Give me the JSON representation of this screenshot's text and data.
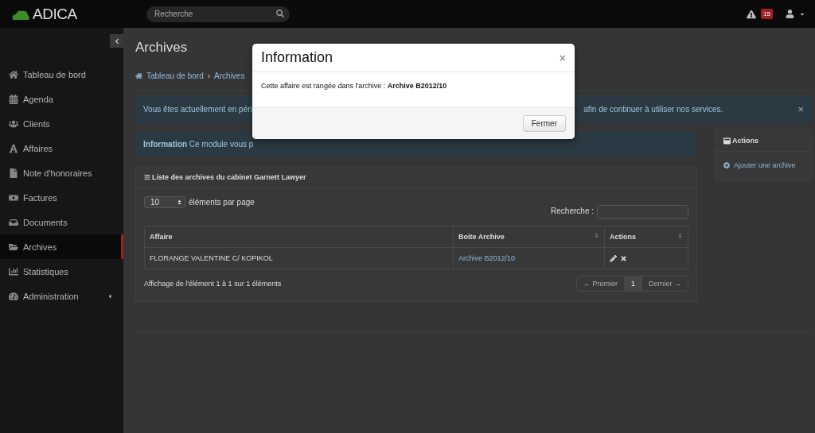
{
  "topbar": {
    "logo": "ADICA",
    "search": {
      "placeholder": "Recherche"
    },
    "alert_count": "15"
  },
  "sidebar": {
    "items": [
      {
        "label": "Tableau de bord",
        "selected": false,
        "submenu": false
      },
      {
        "label": "Agenda",
        "selected": false,
        "submenu": false
      },
      {
        "label": "Clients",
        "selected": false,
        "submenu": false
      },
      {
        "label": "Affaires",
        "selected": false,
        "submenu": false
      },
      {
        "label": "Note d'honoraires",
        "selected": false,
        "submenu": false
      },
      {
        "label": "Factures",
        "selected": false,
        "submenu": false
      },
      {
        "label": "Documents",
        "selected": false,
        "submenu": false
      },
      {
        "label": "Archives",
        "selected": true,
        "submenu": false
      },
      {
        "label": "Statistiques",
        "selected": false,
        "submenu": false
      },
      {
        "label": "Administration",
        "selected": false,
        "submenu": true
      }
    ]
  },
  "page": {
    "title": "Archives",
    "breadcrumb": [
      "Tableau de bord",
      "Archives"
    ],
    "breadcrumb_separator": "›",
    "trial_alert": {
      "start": "Vous êtes actuellement en péri",
      "end": "afin de continuer à utiliser nos services.",
      "close": "×"
    },
    "info_alert": {
      "title": "Information",
      "text": "Ce module vous p"
    },
    "list": {
      "title": "Liste des archives du cabinet Garnett Lawyer",
      "page_size": "10",
      "page_size_label": "éléments par page",
      "search_label": "Recherche :",
      "columns": [
        "Affaire",
        "Boite Archive",
        "Actions"
      ],
      "rows": [
        {
          "affaire": "FLORANGE VALENTINE C/ KOPIKOL",
          "archive": "Archive B2012/10"
        }
      ],
      "info": "Affichage de l'élément 1 à 1 sur 1 éléments",
      "pagination": [
        {
          "label": "← Premier",
          "selected": false
        },
        {
          "label": "1",
          "selected": true
        },
        {
          "label": "Dernier →",
          "selected": false
        }
      ]
    },
    "actions": {
      "title": "Actions",
      "items": [
        "Ajouter une archive"
      ]
    }
  },
  "modal": {
    "title": "Information",
    "close": "×",
    "text": "Cette affaire est rangée dans l'archive : **Archive B2012/10**",
    "button": "Fermer"
  }
}
